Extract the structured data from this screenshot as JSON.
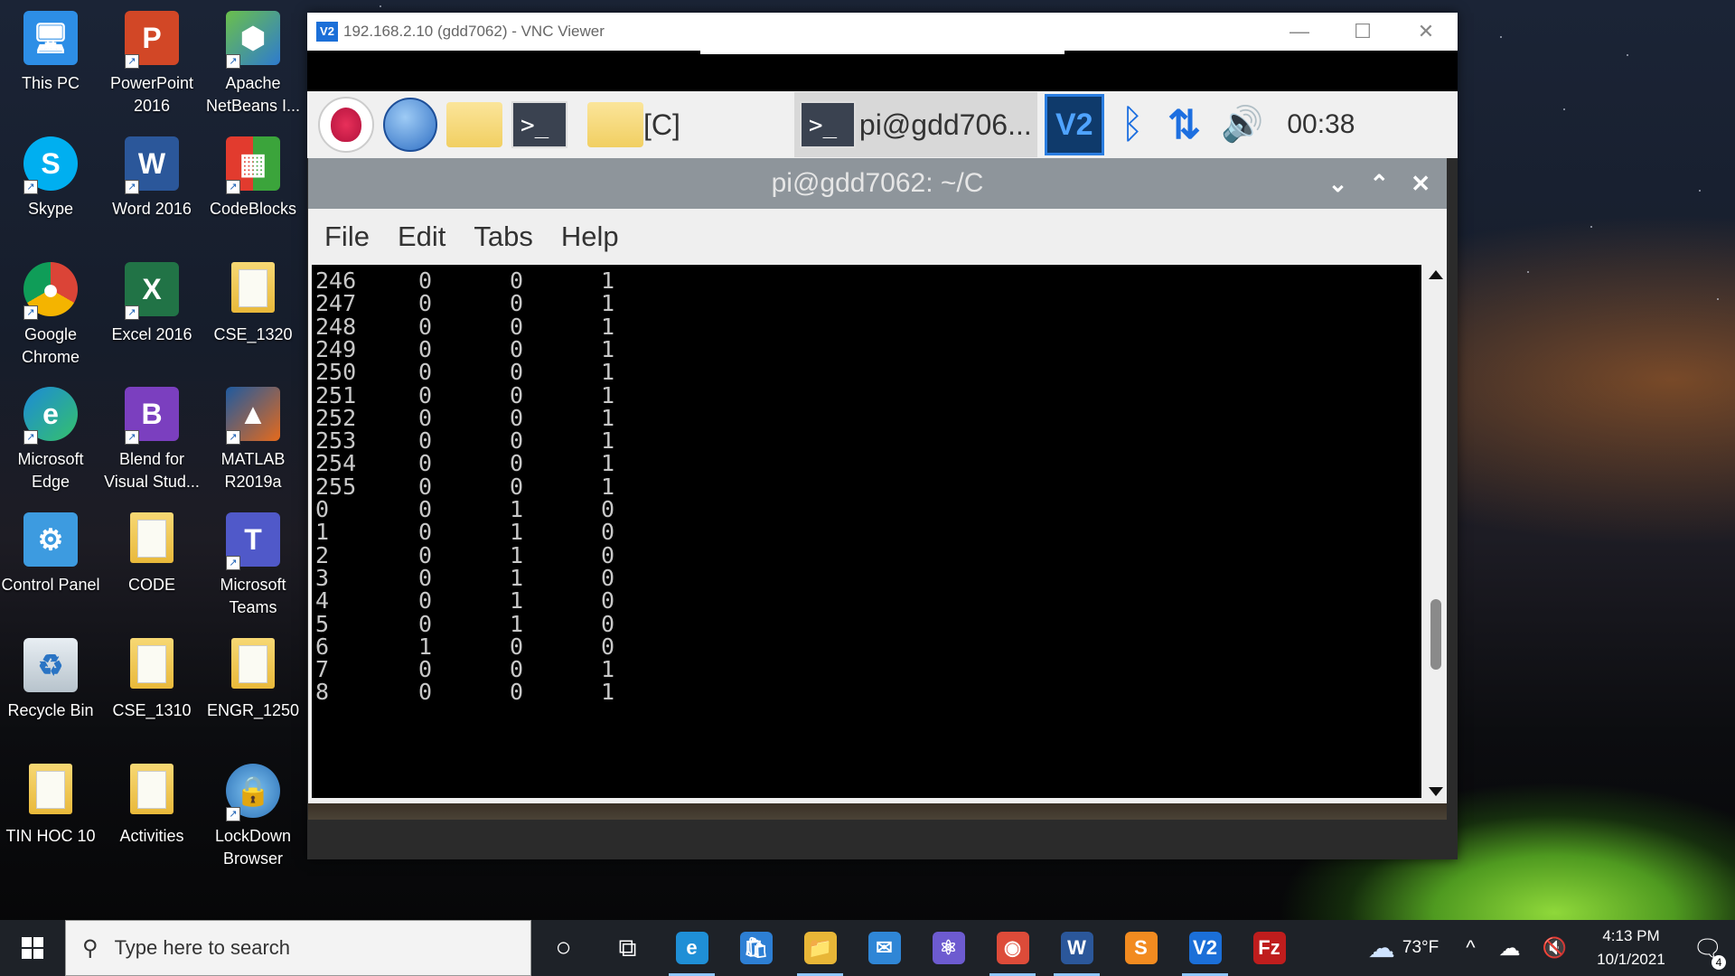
{
  "desktop": {
    "icons": [
      {
        "label": "This PC"
      },
      {
        "label": "PowerPoint 2016"
      },
      {
        "label": "Apache NetBeans I..."
      },
      {
        "label": "Skype"
      },
      {
        "label": "Word 2016"
      },
      {
        "label": "CodeBlocks"
      },
      {
        "label": "Google Chrome"
      },
      {
        "label": "Excel 2016"
      },
      {
        "label": "CSE_1320"
      },
      {
        "label": "Microsoft Edge"
      },
      {
        "label": "Blend for Visual Stud..."
      },
      {
        "label": "MATLAB R2019a"
      },
      {
        "label": "Control Panel"
      },
      {
        "label": "CODE"
      },
      {
        "label": "Microsoft Teams"
      },
      {
        "label": "Recycle Bin"
      },
      {
        "label": "CSE_1310"
      },
      {
        "label": "ENGR_1250"
      },
      {
        "label": "TIN HOC 10"
      },
      {
        "label": "Activities"
      },
      {
        "label": "LockDown Browser"
      }
    ]
  },
  "vnc": {
    "logo": "V2",
    "title": "192.168.2.10 (gdd7062) - VNC Viewer",
    "minimize": "—",
    "maximize": "☐",
    "close": "✕"
  },
  "pi_taskbar": {
    "terminal_glyph": ">_",
    "folder_label": "[C]",
    "active_task": "pi@gdd706...",
    "vnc_glyph": "V2",
    "bluetooth_glyph": "ᛒ",
    "network_glyph": "⇅",
    "volume_glyph": "🔊",
    "clock": "00:38"
  },
  "terminal": {
    "title": "pi@gdd7062: ~/C",
    "controls": {
      "minimize": "⌄",
      "maximize": "⌃",
      "close": "✕"
    },
    "menu": [
      "File",
      "Edit",
      "Tabs",
      "Help"
    ],
    "rows": [
      [
        "246",
        "0",
        "0",
        "1"
      ],
      [
        "247",
        "0",
        "0",
        "1"
      ],
      [
        "248",
        "0",
        "0",
        "1"
      ],
      [
        "249",
        "0",
        "0",
        "1"
      ],
      [
        "250",
        "0",
        "0",
        "1"
      ],
      [
        "251",
        "0",
        "0",
        "1"
      ],
      [
        "252",
        "0",
        "0",
        "1"
      ],
      [
        "253",
        "0",
        "0",
        "1"
      ],
      [
        "254",
        "0",
        "0",
        "1"
      ],
      [
        "255",
        "0",
        "0",
        "1"
      ],
      [
        "0",
        "0",
        "1",
        "0"
      ],
      [
        "1",
        "0",
        "1",
        "0"
      ],
      [
        "2",
        "0",
        "1",
        "0"
      ],
      [
        "3",
        "0",
        "1",
        "0"
      ],
      [
        "4",
        "0",
        "1",
        "0"
      ],
      [
        "5",
        "0",
        "1",
        "0"
      ],
      [
        "6",
        "1",
        "0",
        "0"
      ],
      [
        "7",
        "0",
        "0",
        "1"
      ],
      [
        "8",
        "0",
        "0",
        "1"
      ]
    ]
  },
  "windows_taskbar": {
    "search_placeholder": "Type here to search",
    "search_glyph": "⚲",
    "cortana_glyph": "○",
    "taskview_glyph": "⧉",
    "apps": [
      {
        "name": "edge",
        "glyph": "e",
        "color": "#1f8fd6"
      },
      {
        "name": "store",
        "glyph": "🛍",
        "color": "#2d7fd4"
      },
      {
        "name": "file-explorer",
        "glyph": "📁",
        "color": "#e8b637"
      },
      {
        "name": "mail",
        "glyph": "✉",
        "color": "#2f86d6"
      },
      {
        "name": "atom",
        "glyph": "⚛",
        "color": "#6d5bd0"
      },
      {
        "name": "chrome",
        "glyph": "◉",
        "color": "#dd4b39"
      },
      {
        "name": "word",
        "glyph": "W",
        "color": "#2b579a"
      },
      {
        "name": "sublime",
        "glyph": "S",
        "color": "#f28b20"
      },
      {
        "name": "vnc-viewer",
        "glyph": "V2",
        "color": "#1b6fd8"
      },
      {
        "name": "filezilla",
        "glyph": "Fz",
        "color": "#bf1d1d"
      }
    ],
    "weather_glyph": "☁",
    "weather": "73°F",
    "tray_up_glyph": "^",
    "onedrive_glyph": "☁",
    "volume_glyph": "🔇",
    "time": "4:13 PM",
    "date": "10/1/2021",
    "notification_glyph": "🗨",
    "notification_count": "4"
  }
}
